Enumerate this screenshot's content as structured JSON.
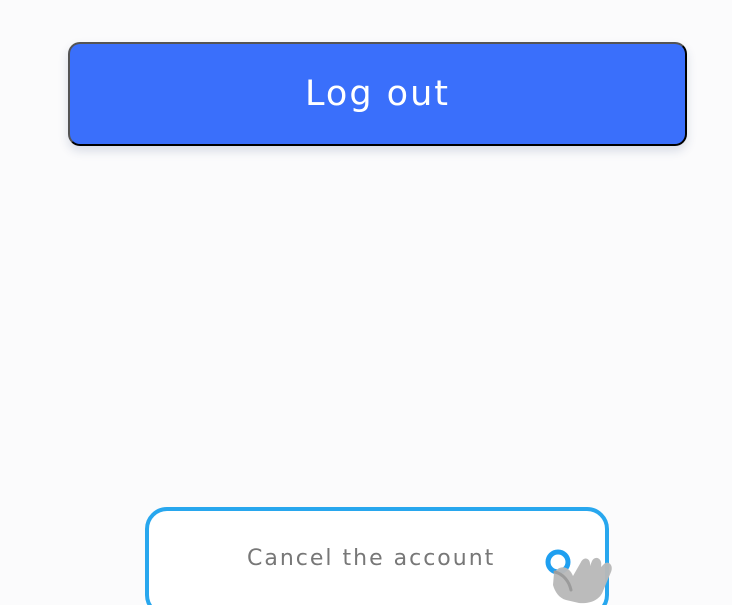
{
  "actions": {
    "logout_label": "Log out",
    "cancel_account_label": "Cancel the account"
  },
  "icons": {
    "tap_indicator": "hand-pointer-tap-icon"
  },
  "colors": {
    "primary_button": "#3a6ffb",
    "button_text": "#ffffff",
    "highlight_outline": "#28a7ee",
    "cancel_text": "#777777",
    "background": "#fbfbfc"
  }
}
